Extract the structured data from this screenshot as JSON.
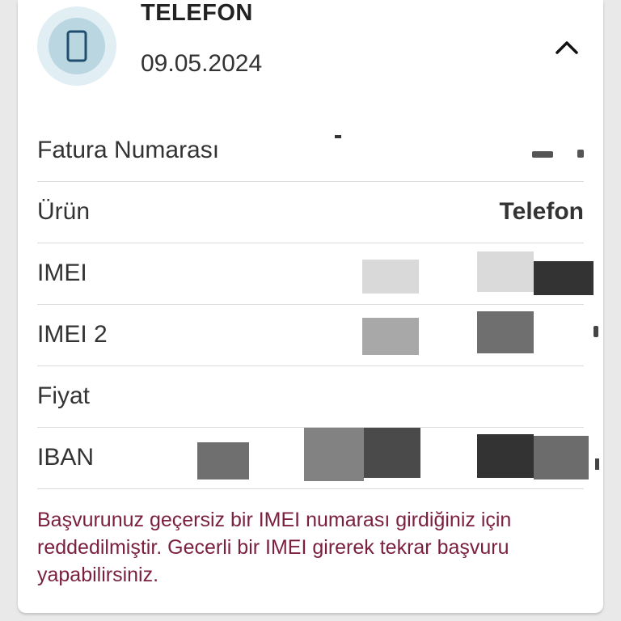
{
  "header": {
    "title": "TELEFON",
    "date": "09.05.2024",
    "icon": "phone-icon",
    "collapse_icon": "chevron-up-icon"
  },
  "rows": [
    {
      "label": "Fatura Numarası",
      "value": ""
    },
    {
      "label": "Ürün",
      "value": "Telefon"
    },
    {
      "label": "IMEI",
      "value": ""
    },
    {
      "label": "IMEI 2",
      "value": ""
    },
    {
      "label": "Fiyat",
      "value": ""
    },
    {
      "label": "IBAN",
      "value": ""
    }
  ],
  "message": "Başvurunuz geçersiz bir IMEI numarası girdiğiniz için reddedilmiştir. Gecerli bir IMEI girerek tekrar başvuru yapabilirsiniz.",
  "colors": {
    "error_text": "#7a1f3d",
    "avatar_outer": "#e1eef3",
    "avatar_inner": "#b9d6e1",
    "icon_stroke": "#1f4e6e"
  }
}
